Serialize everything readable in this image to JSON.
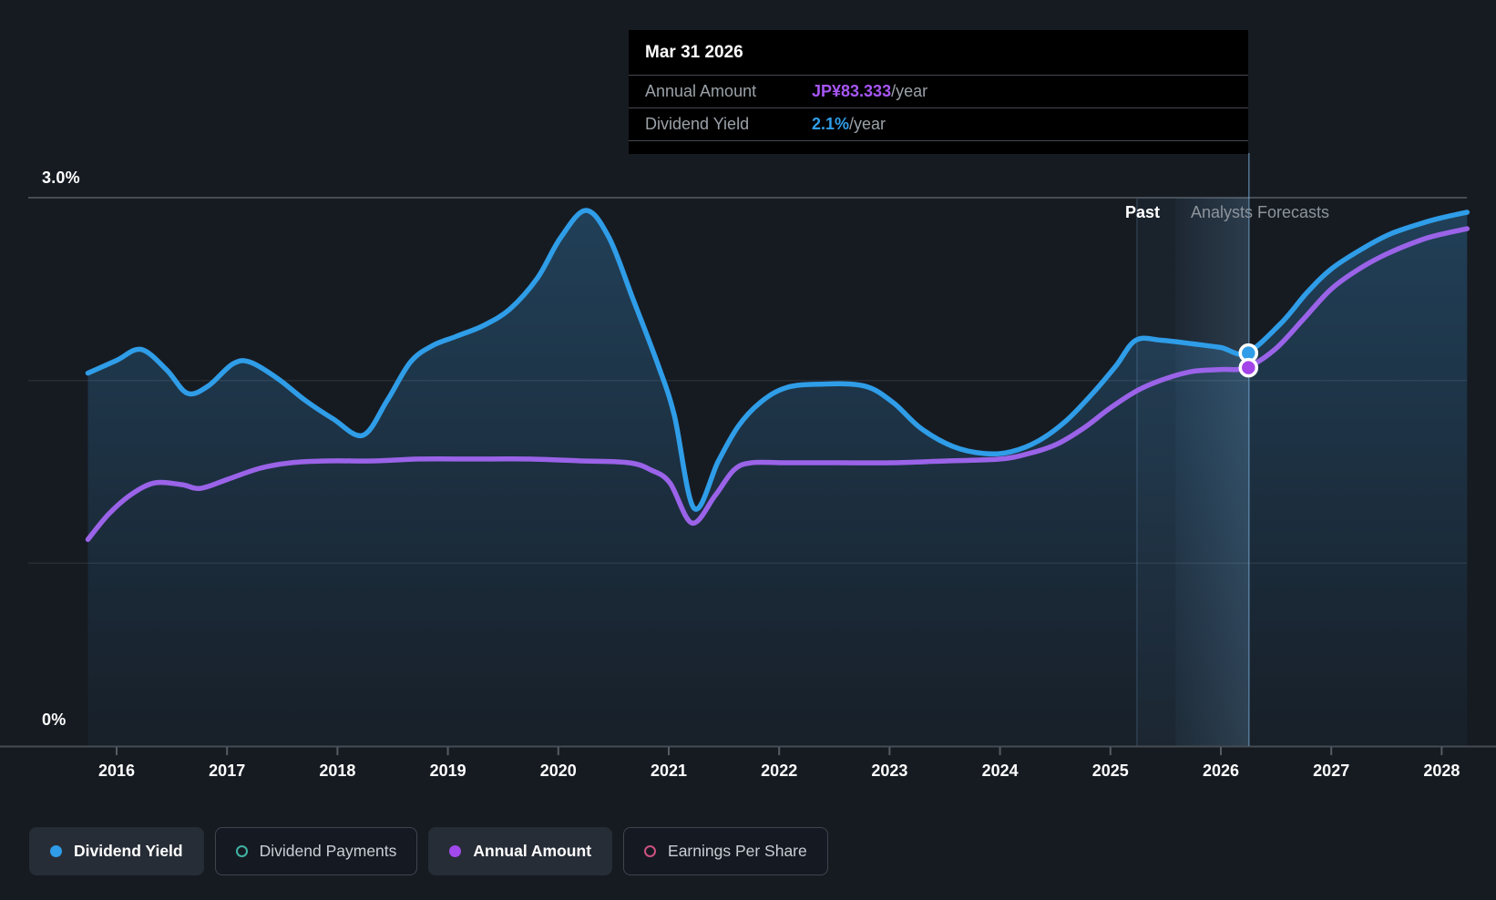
{
  "page": {
    "background": "#161b22"
  },
  "tooltip": {
    "date": "Mar 31 2026",
    "rows": [
      {
        "label": "Annual Amount",
        "value": "JP¥83.333",
        "suffix": "/year",
        "color": "#a656f5"
      },
      {
        "label": "Dividend Yield",
        "value": "2.1%",
        "suffix": "/year",
        "color": "#2f9de8"
      }
    ]
  },
  "axes": {
    "y_top_label": "3.0%",
    "y_bottom_label": "0%",
    "x_ticks": [
      "2016",
      "2017",
      "2018",
      "2019",
      "2020",
      "2021",
      "2022",
      "2023",
      "2024",
      "2025",
      "2026",
      "2027",
      "2028"
    ]
  },
  "annotations": {
    "past": "Past",
    "forecast": "Analysts Forecasts"
  },
  "legend": [
    {
      "label": "Dividend Yield",
      "color": "#2f9de8",
      "style": "filled",
      "active": true
    },
    {
      "label": "Dividend Payments",
      "color": "#41b3a3",
      "style": "ring",
      "active": false
    },
    {
      "label": "Annual Amount",
      "color": "#a149ec",
      "style": "filled",
      "active": true
    },
    {
      "label": "Earnings Per Share",
      "color": "#cb5180",
      "style": "ring",
      "active": false
    }
  ],
  "chart_data": {
    "type": "area",
    "title": "Dividend history and forecast",
    "ylabel": "Dividend Yield",
    "ylim": [
      0,
      3.0
    ],
    "x_range": [
      2015.74,
      2028.23
    ],
    "grid": true,
    "gridlines_pct": [
      3.0,
      2.0,
      1.0,
      0.0
    ],
    "past_forecast_divider_x": 2025.24,
    "hover": {
      "x": 2026.25,
      "date": "Mar 31 2026",
      "dividend_yield_pct": 2.15,
      "annual_amount": "JP¥83.333/year",
      "annual_amount_pct_pos": 2.07
    },
    "series": [
      {
        "name": "Dividend Yield",
        "color": "#2f9de8",
        "area_fill": true,
        "points": [
          [
            2015.74,
            2.04
          ],
          [
            2016.0,
            2.11
          ],
          [
            2016.22,
            2.17
          ],
          [
            2016.45,
            2.06
          ],
          [
            2016.64,
            1.93
          ],
          [
            2016.83,
            1.97
          ],
          [
            2017.05,
            2.09
          ],
          [
            2017.21,
            2.1
          ],
          [
            2017.46,
            2.01
          ],
          [
            2017.71,
            1.89
          ],
          [
            2017.96,
            1.79
          ],
          [
            2018.23,
            1.7
          ],
          [
            2018.45,
            1.89
          ],
          [
            2018.66,
            2.1
          ],
          [
            2018.86,
            2.19
          ],
          [
            2019.07,
            2.24
          ],
          [
            2019.32,
            2.3
          ],
          [
            2019.56,
            2.39
          ],
          [
            2019.81,
            2.56
          ],
          [
            2020.02,
            2.78
          ],
          [
            2020.25,
            2.93
          ],
          [
            2020.46,
            2.78
          ],
          [
            2020.68,
            2.44
          ],
          [
            2020.9,
            2.09
          ],
          [
            2021.05,
            1.81
          ],
          [
            2021.23,
            1.3
          ],
          [
            2021.45,
            1.56
          ],
          [
            2021.63,
            1.75
          ],
          [
            2021.83,
            1.88
          ],
          [
            2022.06,
            1.96
          ],
          [
            2022.37,
            1.98
          ],
          [
            2022.77,
            1.97
          ],
          [
            2023.03,
            1.88
          ],
          [
            2023.28,
            1.74
          ],
          [
            2023.57,
            1.64
          ],
          [
            2023.86,
            1.6
          ],
          [
            2024.1,
            1.61
          ],
          [
            2024.35,
            1.67
          ],
          [
            2024.6,
            1.78
          ],
          [
            2024.84,
            1.93
          ],
          [
            2025.05,
            2.08
          ],
          [
            2025.23,
            2.22
          ],
          [
            2025.46,
            2.22
          ],
          [
            2025.75,
            2.2
          ],
          [
            2026.0,
            2.18
          ],
          [
            2026.23,
            2.15
          ],
          [
            2026.54,
            2.31
          ],
          [
            2026.78,
            2.48
          ],
          [
            2027.0,
            2.61
          ],
          [
            2027.28,
            2.72
          ],
          [
            2027.53,
            2.8
          ],
          [
            2027.82,
            2.86
          ],
          [
            2028.0,
            2.89
          ],
          [
            2028.23,
            2.92
          ]
        ]
      },
      {
        "name": "Annual Amount",
        "color": "#9a63e8",
        "area_fill": false,
        "axis_note": "plotted against a hidden JP¥ axis; values below are positions expressed on the % axis",
        "points": [
          [
            2015.74,
            1.13
          ],
          [
            2015.93,
            1.27
          ],
          [
            2016.14,
            1.38
          ],
          [
            2016.35,
            1.44
          ],
          [
            2016.59,
            1.43
          ],
          [
            2016.76,
            1.41
          ],
          [
            2017.01,
            1.46
          ],
          [
            2017.3,
            1.52
          ],
          [
            2017.58,
            1.55
          ],
          [
            2017.91,
            1.56
          ],
          [
            2018.33,
            1.56
          ],
          [
            2018.74,
            1.57
          ],
          [
            2019.23,
            1.57
          ],
          [
            2019.73,
            1.57
          ],
          [
            2020.22,
            1.56
          ],
          [
            2020.64,
            1.55
          ],
          [
            2020.84,
            1.51
          ],
          [
            2021.01,
            1.44
          ],
          [
            2021.21,
            1.22
          ],
          [
            2021.42,
            1.37
          ],
          [
            2021.59,
            1.51
          ],
          [
            2021.75,
            1.55
          ],
          [
            2022.04,
            1.55
          ],
          [
            2022.53,
            1.55
          ],
          [
            2023.03,
            1.55
          ],
          [
            2023.52,
            1.56
          ],
          [
            2024.0,
            1.57
          ],
          [
            2024.26,
            1.6
          ],
          [
            2024.51,
            1.65
          ],
          [
            2024.76,
            1.74
          ],
          [
            2025.0,
            1.85
          ],
          [
            2025.26,
            1.95
          ],
          [
            2025.5,
            2.01
          ],
          [
            2025.75,
            2.05
          ],
          [
            2026.0,
            2.06
          ],
          [
            2026.23,
            2.07
          ],
          [
            2026.49,
            2.17
          ],
          [
            2026.74,
            2.33
          ],
          [
            2027.0,
            2.5
          ],
          [
            2027.28,
            2.62
          ],
          [
            2027.53,
            2.7
          ],
          [
            2027.82,
            2.77
          ],
          [
            2028.0,
            2.8
          ],
          [
            2028.23,
            2.83
          ]
        ]
      }
    ]
  }
}
